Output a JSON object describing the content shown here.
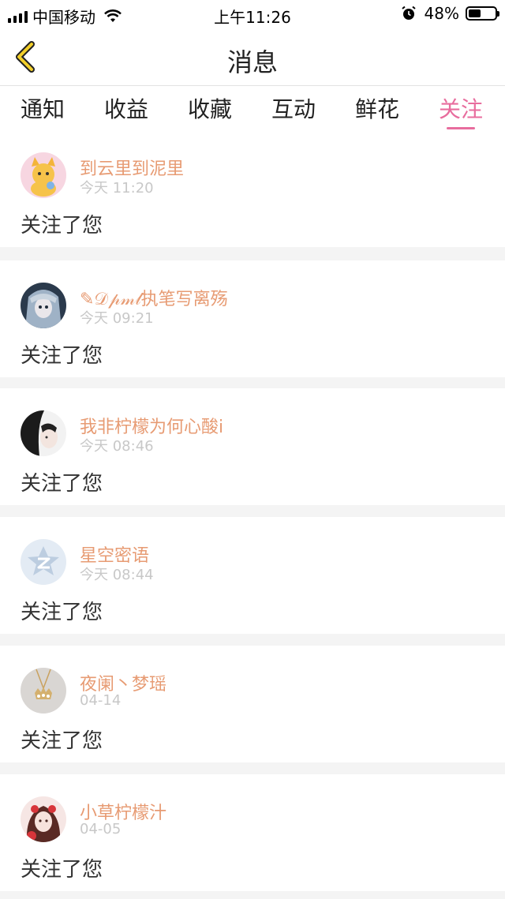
{
  "status_bar": {
    "carrier": "中国移动",
    "time": "上午11:26",
    "battery_percent": "48%",
    "battery_level": 0.48,
    "icons": [
      "signal-icon",
      "wifi-icon",
      "alarm-icon",
      "battery-icon"
    ]
  },
  "nav": {
    "title": "消息",
    "back_icon": "chevron-left-icon",
    "accent_color": "#f2cf2a"
  },
  "tabs": [
    {
      "label": "通知",
      "active": false
    },
    {
      "label": "收益",
      "active": false
    },
    {
      "label": "收藏",
      "active": false
    },
    {
      "label": "互动",
      "active": false
    },
    {
      "label": "鲜花",
      "active": false
    },
    {
      "label": "关注",
      "active": true
    }
  ],
  "colors": {
    "active_tab": "#e86d9e",
    "username": "#e79b73",
    "time": "#c8c8c8"
  },
  "notifications": [
    {
      "username": "到云里到泥里",
      "time": "今天 11:20",
      "message": "关注了您",
      "avatar": "fox-cartoon-avatar"
    },
    {
      "username": "✎𝒟𝓅𝓂𝓁执笔写离殇",
      "time": "今天 09:21",
      "message": "关注了您",
      "avatar": "anime-girl-avatar"
    },
    {
      "username": "我非柠檬为何心酸i",
      "time": "今天 08:46",
      "message": "关注了您",
      "avatar": "girl-photo-avatar"
    },
    {
      "username": "星空密语",
      "time": "今天 08:44",
      "message": "关注了您",
      "avatar": "default-qzone-avatar"
    },
    {
      "username": "夜阑丶梦瑶",
      "time": "04-14",
      "message": "关注了您",
      "avatar": "necklace-avatar"
    },
    {
      "username": "小草柠檬汁",
      "time": "04-05",
      "message": "关注了您",
      "avatar": "illustration-girl-avatar"
    }
  ]
}
